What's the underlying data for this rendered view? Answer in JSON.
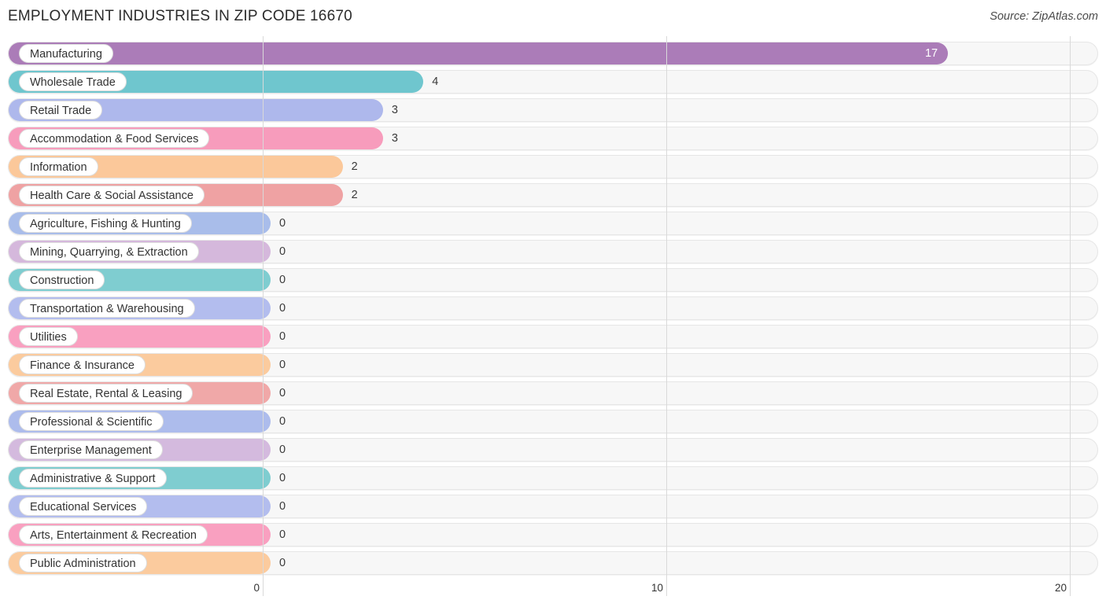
{
  "header": {
    "title": "EMPLOYMENT INDUSTRIES IN ZIP CODE 16670",
    "source": "Source: ZipAtlas.com"
  },
  "chart_data": {
    "type": "bar",
    "orientation": "horizontal",
    "title": "EMPLOYMENT INDUSTRIES IN ZIP CODE 16670",
    "xlabel": "",
    "ylabel": "",
    "xlim": [
      0,
      20
    ],
    "xticks": [
      0,
      10,
      20
    ],
    "xtick_labels": [
      "0",
      "10",
      "20"
    ],
    "grid": true,
    "legend": "none",
    "categories": [
      "Manufacturing",
      "Wholesale Trade",
      "Retail Trade",
      "Accommodation & Food Services",
      "Information",
      "Health Care & Social Assistance",
      "Agriculture, Fishing & Hunting",
      "Mining, Quarrying, & Extraction",
      "Construction",
      "Transportation & Warehousing",
      "Utilities",
      "Finance & Insurance",
      "Real Estate, Rental & Leasing",
      "Professional & Scientific",
      "Enterprise Management",
      "Administrative & Support",
      "Educational Services",
      "Arts, Entertainment & Recreation",
      "Public Administration"
    ],
    "values": [
      17,
      4,
      3,
      3,
      2,
      2,
      0,
      0,
      0,
      0,
      0,
      0,
      0,
      0,
      0,
      0,
      0,
      0,
      0
    ],
    "value_labels": [
      "17",
      "4",
      "3",
      "3",
      "2",
      "2",
      "0",
      "0",
      "0",
      "0",
      "0",
      "0",
      "0",
      "0",
      "0",
      "0",
      "0",
      "0",
      "0"
    ],
    "bar_colors": [
      "#ab7cb8",
      "#6fc6ce",
      "#aeb8ec",
      "#f79cbc",
      "#fbc89a",
      "#efa2a3",
      "#a9bdea",
      "#d5b8dc",
      "#7fcdd0",
      "#b3bdee",
      "#f9a0c0",
      "#fbcb9e",
      "#f0a8a8",
      "#adbcec",
      "#d4bade",
      "#7fcdd0",
      "#b3bdee",
      "#f9a0c0",
      "#fbcb9e"
    ]
  },
  "colors": {
    "purple": "#ab7cb8",
    "teal": "#6fc6ce",
    "periwinkle": "#aeb8ec",
    "pink": "#f79cbc",
    "orange": "#fbc89a",
    "salmon": "#efa2a3",
    "track": "#f7f7f7",
    "gridline": "#d9d9d9",
    "text": "#333333"
  }
}
